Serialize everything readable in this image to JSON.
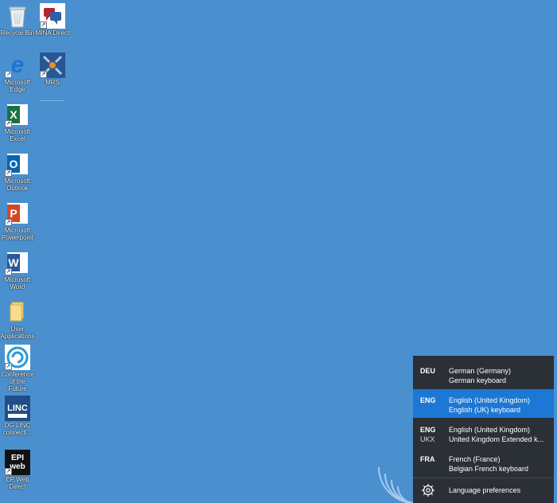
{
  "desktop": {
    "background": "#4a90cf",
    "icons": [
      {
        "label": "Recycle Bin",
        "icon": "recycle-bin-icon"
      },
      {
        "label": "MINA Direct",
        "icon": "mina-direct-icon"
      },
      {
        "label": "Microsoft Edge",
        "icon": "edge-icon"
      },
      {
        "label": "MRS",
        "icon": "mrs-icon"
      },
      {
        "label": "Microsoft Excel",
        "icon": "excel-icon",
        "glyph": "X"
      },
      {
        "label": "Microsoft Outlook",
        "icon": "outlook-icon",
        "glyph": "O"
      },
      {
        "label": "Microsoft Powerpoint",
        "icon": "powerpoint-icon",
        "glyph": "P"
      },
      {
        "label": "Microsoft Word",
        "icon": "word-icon",
        "glyph": "W"
      },
      {
        "label": "User Applications",
        "icon": "folder-icon"
      },
      {
        "label": "Conference of the Future",
        "icon": "conference-icon"
      },
      {
        "label": "DG LINC connecti...",
        "icon": "linc-icon",
        "glyph": "LINC"
      },
      {
        "label": "EP Web Direct",
        "icon": "epweb-icon",
        "glyph": "EPI web"
      }
    ]
  },
  "language_flyout": {
    "items": [
      {
        "code": "DEU",
        "sub": "",
        "name": "German (Germany)",
        "keyboard": "German keyboard",
        "selected": false
      },
      {
        "code": "ENG",
        "sub": "",
        "name": "English (United Kingdom)",
        "keyboard": "English (UK) keyboard",
        "selected": true
      },
      {
        "code": "ENG",
        "sub": "UKX",
        "name": "English (United Kingdom)",
        "keyboard": "United Kingdom Extended k...",
        "selected": false
      },
      {
        "code": "FRA",
        "sub": "",
        "name": "French (France)",
        "keyboard": "Belgian French keyboard",
        "selected": false
      }
    ],
    "preferences_label": "Language preferences",
    "preferences_icon": "gear-icon",
    "background": "#2b2f36",
    "selected_color": "#1c78d4"
  }
}
